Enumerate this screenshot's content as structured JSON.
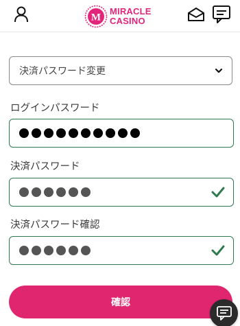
{
  "header": {
    "logo": {
      "line1": "MIRACLE",
      "line2": "CASINO",
      "mark": "M"
    },
    "icons": [
      "user-icon",
      "mail-icon",
      "chat-icon"
    ]
  },
  "form": {
    "select": {
      "value": "決済パスワード変更"
    },
    "fields": [
      {
        "label": "ログインパスワード",
        "masked_length": 10,
        "valid": false
      },
      {
        "label": "決済パスワード",
        "masked_length": 6,
        "valid": true
      },
      {
        "label": "決済パスワード確認",
        "masked_length": 6,
        "valid": true
      }
    ],
    "submit_label": "確認"
  },
  "colors": {
    "brand": "#e0257b",
    "button": "#e0266f",
    "input_border": "#2e7a4f",
    "check": "#2e7a4f"
  }
}
